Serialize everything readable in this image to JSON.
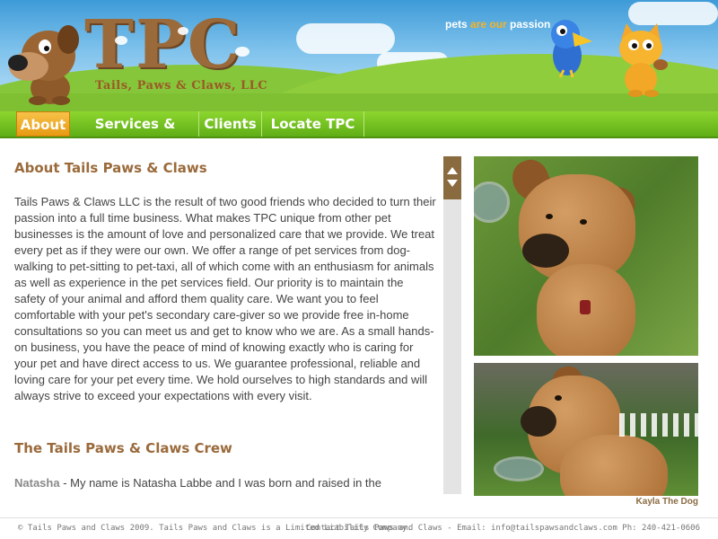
{
  "header": {
    "logo_title": "TPC",
    "logo_subtitle": "Tails, Paws & Claws, LLC",
    "tagline_pre": "pets ",
    "tagline_accent": "are our",
    "tagline_post": " passion"
  },
  "nav": {
    "items": [
      {
        "label": "About",
        "active": true
      },
      {
        "label": "Services & Prices",
        "active": false
      },
      {
        "label": "Clients",
        "active": false
      },
      {
        "label": "Locate TPC",
        "active": false
      }
    ]
  },
  "main": {
    "about_title": "About Tails Paws & Claws",
    "about_body": "Tails Paws & Claws LLC is the result of two good friends who decided to turn their passion into a full time business. What makes TPC unique from other pet businesses is the amount of love and personalized care that we provide. We treat every pet as if they were our own. We offer a range of pet services from dog-walking to pet-sitting to pet-taxi, all of which come with an enthusiasm for animals as well as experience in the pet services field. Our priority is to maintain the safety of your animal and afford them quality care. We want you to feel comfortable with your pet's secondary care-giver so we provide free in-home consultations so you can meet us and get to know who we are. As a small hands-on business, you have the peace of mind of knowing exactly who is caring for your pet and have direct access to us. We guarantee professional, reliable and loving care for your pet every time. We hold ourselves to high standards and will always strive to exceed your expectations with every visit.",
    "crew_title": "The Tails Paws & Claws Crew",
    "crew_name": "Natasha",
    "crew_text": " - My name is Natasha Labbe and I was born and raised in the"
  },
  "photos": {
    "caption": "Kayla The Dog"
  },
  "footer": {
    "left": "© Tails Paws and Claws 2009. Tails Paws and Claws is a Limited Liability Company.",
    "right": "Contact Tails Paws and Claws - Email: info@tailspawsandclaws.com Ph: 240-421-0606"
  },
  "colors": {
    "nav_green": "#6cbf1f",
    "nav_active": "#f0aa24",
    "heading_brown": "#9a6a3b",
    "tagline_accent": "#f6b324"
  }
}
